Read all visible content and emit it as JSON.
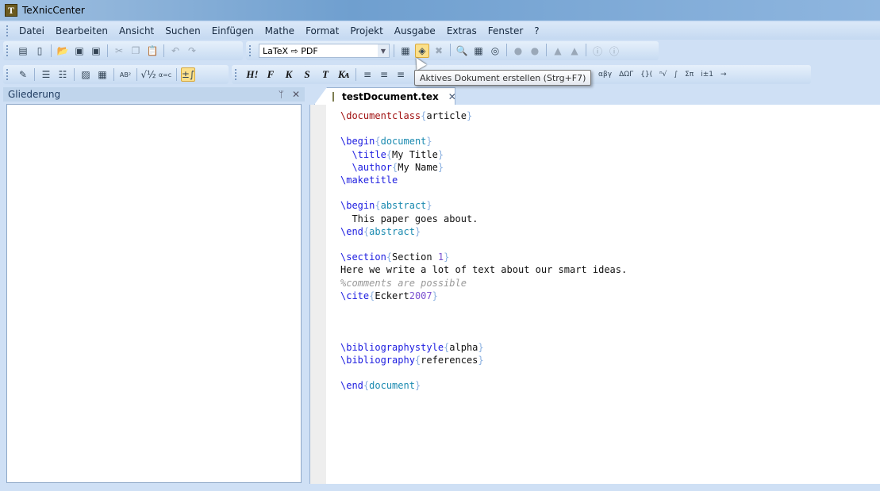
{
  "window": {
    "title": "TeXnicCenter",
    "icon": "T"
  },
  "menu": [
    "Datei",
    "Bearbeiten",
    "Ansicht",
    "Suchen",
    "Einfügen",
    "Mathe",
    "Format",
    "Projekt",
    "Ausgabe",
    "Extras",
    "Fenster",
    "?"
  ],
  "toolbar1": {
    "left_icons": [
      "new-project-icon",
      "new-file-icon",
      "open-icon",
      "save-icon",
      "save-all-icon",
      "cut-icon",
      "copy-icon",
      "paste-icon",
      "undo-icon",
      "redo-icon"
    ],
    "output_profile": "LaTeX ⇨ PDF",
    "right_icons": [
      "build-all-icon",
      "build-current-icon",
      "cancel-build-icon",
      "view-output-icon",
      "bibtex-icon",
      "makeindex-icon",
      "next-error-icon",
      "prev-error-icon",
      "next-warning-icon",
      "prev-warning-icon",
      "next-badbox-icon",
      "prev-badbox-icon"
    ]
  },
  "toolbar2": {
    "format_buttons": [
      "H!",
      "F",
      "K",
      "S",
      "T",
      "Kᴀ"
    ],
    "tooltip": "Aktives Dokument erstellen (Strg+F7)",
    "math_symbols": [
      "∃∀",
      "∈∪⊆",
      "∂∞∠",
      "αβγ",
      "ΔΩΓ",
      "{}(",
      "ⁿ√",
      "∫",
      "Σπ",
      "i±1",
      "→"
    ]
  },
  "panel": {
    "title": "Gliederung",
    "pin": "📌",
    "close": "✕"
  },
  "tab": {
    "label": "testDocument.tex",
    "close": "✕"
  },
  "code": [
    [
      {
        "t": "\\documentclass",
        "c": "doc"
      },
      {
        "t": "{",
        "c": "brace"
      },
      {
        "t": "article",
        "c": "text"
      },
      {
        "t": "}",
        "c": "brace"
      }
    ],
    [],
    [
      {
        "t": "\\begin",
        "c": "cmd"
      },
      {
        "t": "{",
        "c": "brace"
      },
      {
        "t": "document",
        "c": "env"
      },
      {
        "t": "}",
        "c": "brace"
      }
    ],
    [
      {
        "t": "  \\title",
        "c": "cmd"
      },
      {
        "t": "{",
        "c": "brace"
      },
      {
        "t": "My Title",
        "c": "text"
      },
      {
        "t": "}",
        "c": "brace"
      }
    ],
    [
      {
        "t": "  \\author",
        "c": "cmd"
      },
      {
        "t": "{",
        "c": "brace"
      },
      {
        "t": "My Name",
        "c": "text"
      },
      {
        "t": "}",
        "c": "brace"
      }
    ],
    [
      {
        "t": "\\maketitle",
        "c": "cmd"
      }
    ],
    [],
    [
      {
        "t": "\\begin",
        "c": "cmd"
      },
      {
        "t": "{",
        "c": "brace"
      },
      {
        "t": "abstract",
        "c": "env"
      },
      {
        "t": "}",
        "c": "brace"
      }
    ],
    [
      {
        "t": "  This paper goes about.",
        "c": "text"
      }
    ],
    [
      {
        "t": "\\end",
        "c": "cmd"
      },
      {
        "t": "{",
        "c": "brace"
      },
      {
        "t": "abstract",
        "c": "env"
      },
      {
        "t": "}",
        "c": "brace"
      }
    ],
    [],
    [
      {
        "t": "\\section",
        "c": "cmd"
      },
      {
        "t": "{",
        "c": "brace"
      },
      {
        "t": "Section ",
        "c": "text"
      },
      {
        "t": "1",
        "c": "num"
      },
      {
        "t": "}",
        "c": "brace"
      }
    ],
    [
      {
        "t": "Here we write a lot of text about our smart ideas.",
        "c": "text"
      }
    ],
    [
      {
        "t": "%comments are possible",
        "c": "comment"
      }
    ],
    [
      {
        "t": "\\cite",
        "c": "cmd"
      },
      {
        "t": "{",
        "c": "brace"
      },
      {
        "t": "Eckert",
        "c": "text"
      },
      {
        "t": "2007",
        "c": "num"
      },
      {
        "t": "}",
        "c": "brace"
      }
    ],
    [],
    [],
    [],
    [
      {
        "t": "\\bibliographystyle",
        "c": "cmd"
      },
      {
        "t": "{",
        "c": "brace"
      },
      {
        "t": "alpha",
        "c": "text"
      },
      {
        "t": "}",
        "c": "brace"
      }
    ],
    [
      {
        "t": "\\bibliography",
        "c": "cmd"
      },
      {
        "t": "{",
        "c": "brace"
      },
      {
        "t": "references",
        "c": "text"
      },
      {
        "t": "}",
        "c": "brace"
      }
    ],
    [],
    [
      {
        "t": "\\end",
        "c": "cmd"
      },
      {
        "t": "{",
        "c": "brace"
      },
      {
        "t": "document",
        "c": "env"
      },
      {
        "t": "}",
        "c": "brace"
      }
    ]
  ]
}
